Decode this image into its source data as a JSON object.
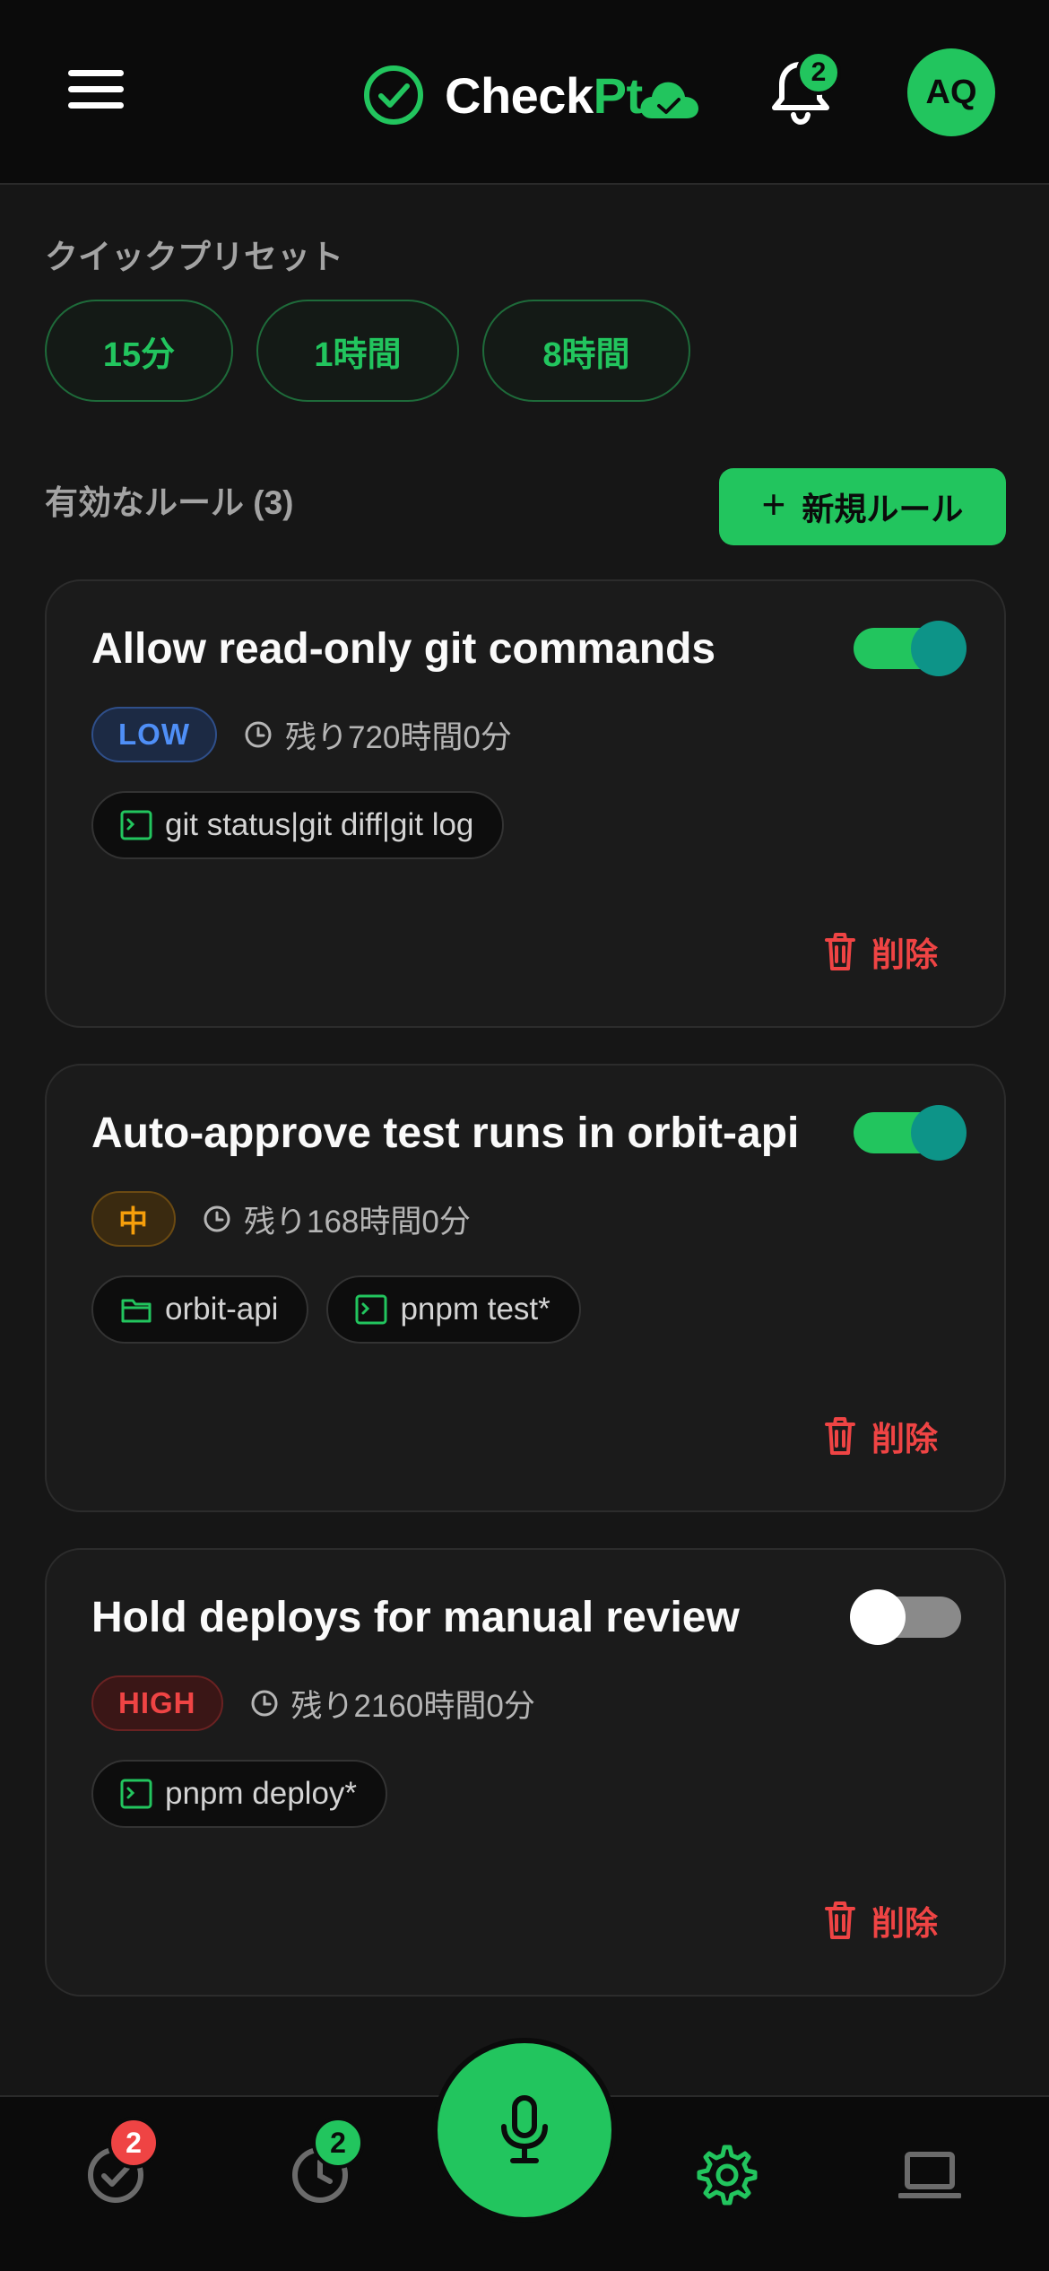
{
  "header": {
    "brand_part1": "Check",
    "brand_part2": "Pt",
    "notification_count": "2",
    "avatar_initials": "AQ",
    "accent_color": "#22c55e"
  },
  "presets": {
    "label": "クイックプリセット",
    "items": [
      "15分",
      "1時間",
      "8時間"
    ]
  },
  "rules_section": {
    "label": "有効なルール (3)",
    "new_rule_label": "新規ルール"
  },
  "rules": [
    {
      "title": "Allow read-only git commands",
      "enabled": true,
      "risk": "LOW",
      "remaining": "残り720時間0分",
      "chips": [
        {
          "icon": "terminal-icon",
          "text": "git status|git diff|git log"
        }
      ],
      "delete_label": "削除"
    },
    {
      "title": "Auto-approve test runs in orbit-api",
      "enabled": true,
      "risk": "中",
      "remaining": "残り168時間0分",
      "chips": [
        {
          "icon": "folder-icon",
          "text": "orbit-api"
        },
        {
          "icon": "terminal-icon",
          "text": "pnpm test*"
        }
      ],
      "delete_label": "削除"
    },
    {
      "title": "Hold deploys for manual review",
      "enabled": false,
      "risk": "HIGH",
      "remaining": "残り2160時間0分",
      "chips": [
        {
          "icon": "terminal-icon",
          "text": "pnpm deploy*"
        }
      ],
      "delete_label": "削除"
    }
  ],
  "bottom_nav": {
    "approvals_badge": "2",
    "history_badge": "2",
    "items": [
      "check-circle-icon",
      "history-icon",
      "microphone-icon",
      "gear-icon",
      "laptop-icon"
    ]
  }
}
